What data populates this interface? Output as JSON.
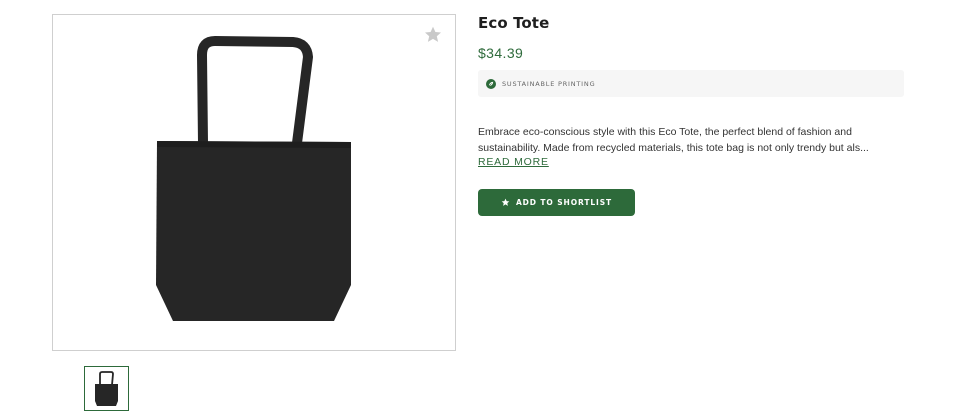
{
  "product": {
    "title": "Eco Tote",
    "price": "$34.39",
    "badge_label": "SUSTAINABLE PRINTING",
    "description_line1": "Embrace eco-conscious style with this Eco Tote, the perfect blend of fashion and",
    "description_line2": "sustainability. Made from recycled materials, this tote bag is not only trendy but als...",
    "read_more_label": "READ MORE",
    "shortlist_label": "ADD TO SHORTLIST"
  },
  "icons": {
    "favorite": "star-icon",
    "badge": "leaf-icon",
    "button": "star-icon"
  },
  "colors": {
    "accent": "#2d6a3a",
    "bag": "#262626",
    "badge_bg": "#f6f6f6"
  }
}
